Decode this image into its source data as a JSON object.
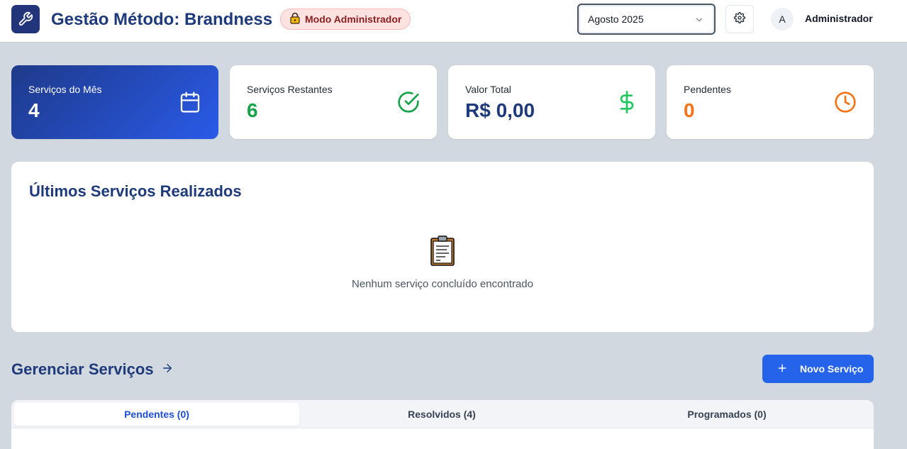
{
  "header": {
    "title": "Gestão Método: Brandness",
    "admin_badge": "Modo Administrador",
    "month_select": "Agosto 2025",
    "avatar_initial": "A",
    "user_name": "Administrador"
  },
  "stats": [
    {
      "label": "Serviços do Mês",
      "value": "4",
      "color": "#ffffff",
      "icon": "calendar-icon"
    },
    {
      "label": "Serviços Restantes",
      "value": "6",
      "color": "#16a34a",
      "icon": "check-circle-icon"
    },
    {
      "label": "Valor Total",
      "value": "R$ 0,00",
      "color": "#1e3a7b",
      "icon": "dollar-icon"
    },
    {
      "label": "Pendentes",
      "value": "0",
      "color": "#f97316",
      "icon": "clock-icon"
    }
  ],
  "latest": {
    "title": "Últimos Serviços Realizados",
    "empty_icon": "clipboard-icon",
    "empty_text": "Nenhum serviço concluído encontrado"
  },
  "manage": {
    "title": "Gerenciar Serviços",
    "new_button": "Novo Serviço",
    "tabs": [
      {
        "label": "Pendentes (0)",
        "active": true
      },
      {
        "label": "Resolvidos (4)",
        "active": false
      },
      {
        "label": "Programados (0)",
        "active": false
      }
    ]
  },
  "colors": {
    "brand_navy": "#1e3a7b",
    "primary_blue": "#2563eb",
    "success_green": "#16a34a",
    "warning_orange": "#f97316",
    "page_bg": "#d2d8e0"
  }
}
